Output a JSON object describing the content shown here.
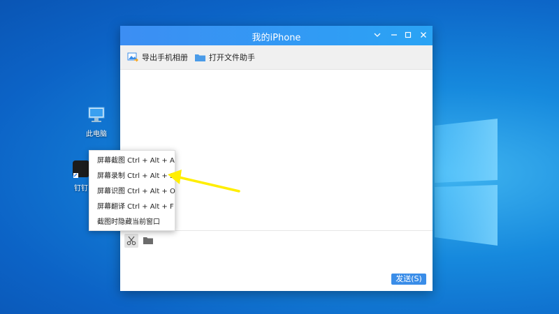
{
  "desktop": {
    "icons": [
      {
        "label": "此电脑",
        "icon": "computer-icon"
      },
      {
        "label": "钉钉",
        "icon": "app-shortcut-icon"
      }
    ]
  },
  "window": {
    "title": "我的iPhone",
    "controls": [
      "chevron-down-icon",
      "minimize-icon",
      "maximize-icon",
      "close-icon"
    ],
    "toolbar": {
      "export_album": "导出手机相册",
      "open_file_helper": "打开文件助手"
    },
    "send_label": "发送(S)"
  },
  "context_menu": {
    "items": [
      "屏幕截图 Ctrl + Alt + A",
      "屏幕录制 Ctrl + Alt + S",
      "屏幕识图 Ctrl + Alt + O",
      "屏幕翻译 Ctrl + Alt + F",
      "截图时隐藏当前窗口"
    ]
  },
  "colors": {
    "title_bar": "#3c8ef3",
    "send_button": "#3a8de8",
    "annotation_arrow": "#ffee00"
  }
}
